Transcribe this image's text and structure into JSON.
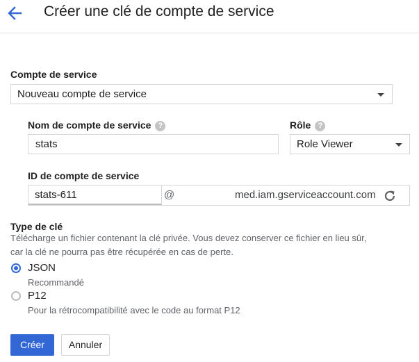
{
  "header": {
    "title": "Créer une clé de compte de service"
  },
  "service_account": {
    "label": "Compte de service",
    "selected": "Nouveau compte de service"
  },
  "name": {
    "label": "Nom de compte de service",
    "value": "stats"
  },
  "role": {
    "label": "Rôle",
    "selected": "Role Viewer"
  },
  "account_id": {
    "label": "ID de compte de service",
    "value": "stats-611",
    "at": "@",
    "domain": "med.iam.gserviceaccount.com"
  },
  "key_type": {
    "label": "Type de clé",
    "description_line1": "Télécharge un fichier contenant la clé privée. Vous devez conserver ce fichier en lieu sûr,",
    "description_line2": "car la clé ne pourra pas être récupérée en cas de perte.",
    "options": [
      {
        "label": "JSON",
        "hint": "Recommandé",
        "selected": true
      },
      {
        "label": "P12",
        "hint": "Pour la rétrocompatibilité avec le code au format P12",
        "selected": false
      }
    ]
  },
  "actions": {
    "create": "Créer",
    "cancel": "Annuler"
  },
  "colors": {
    "accent": "#3367d6",
    "border": "#d6d6d6"
  },
  "icons": {
    "back": "arrow-back-icon",
    "help": "help-icon",
    "refresh": "refresh-icon",
    "dropdown": "caret-down-icon"
  }
}
